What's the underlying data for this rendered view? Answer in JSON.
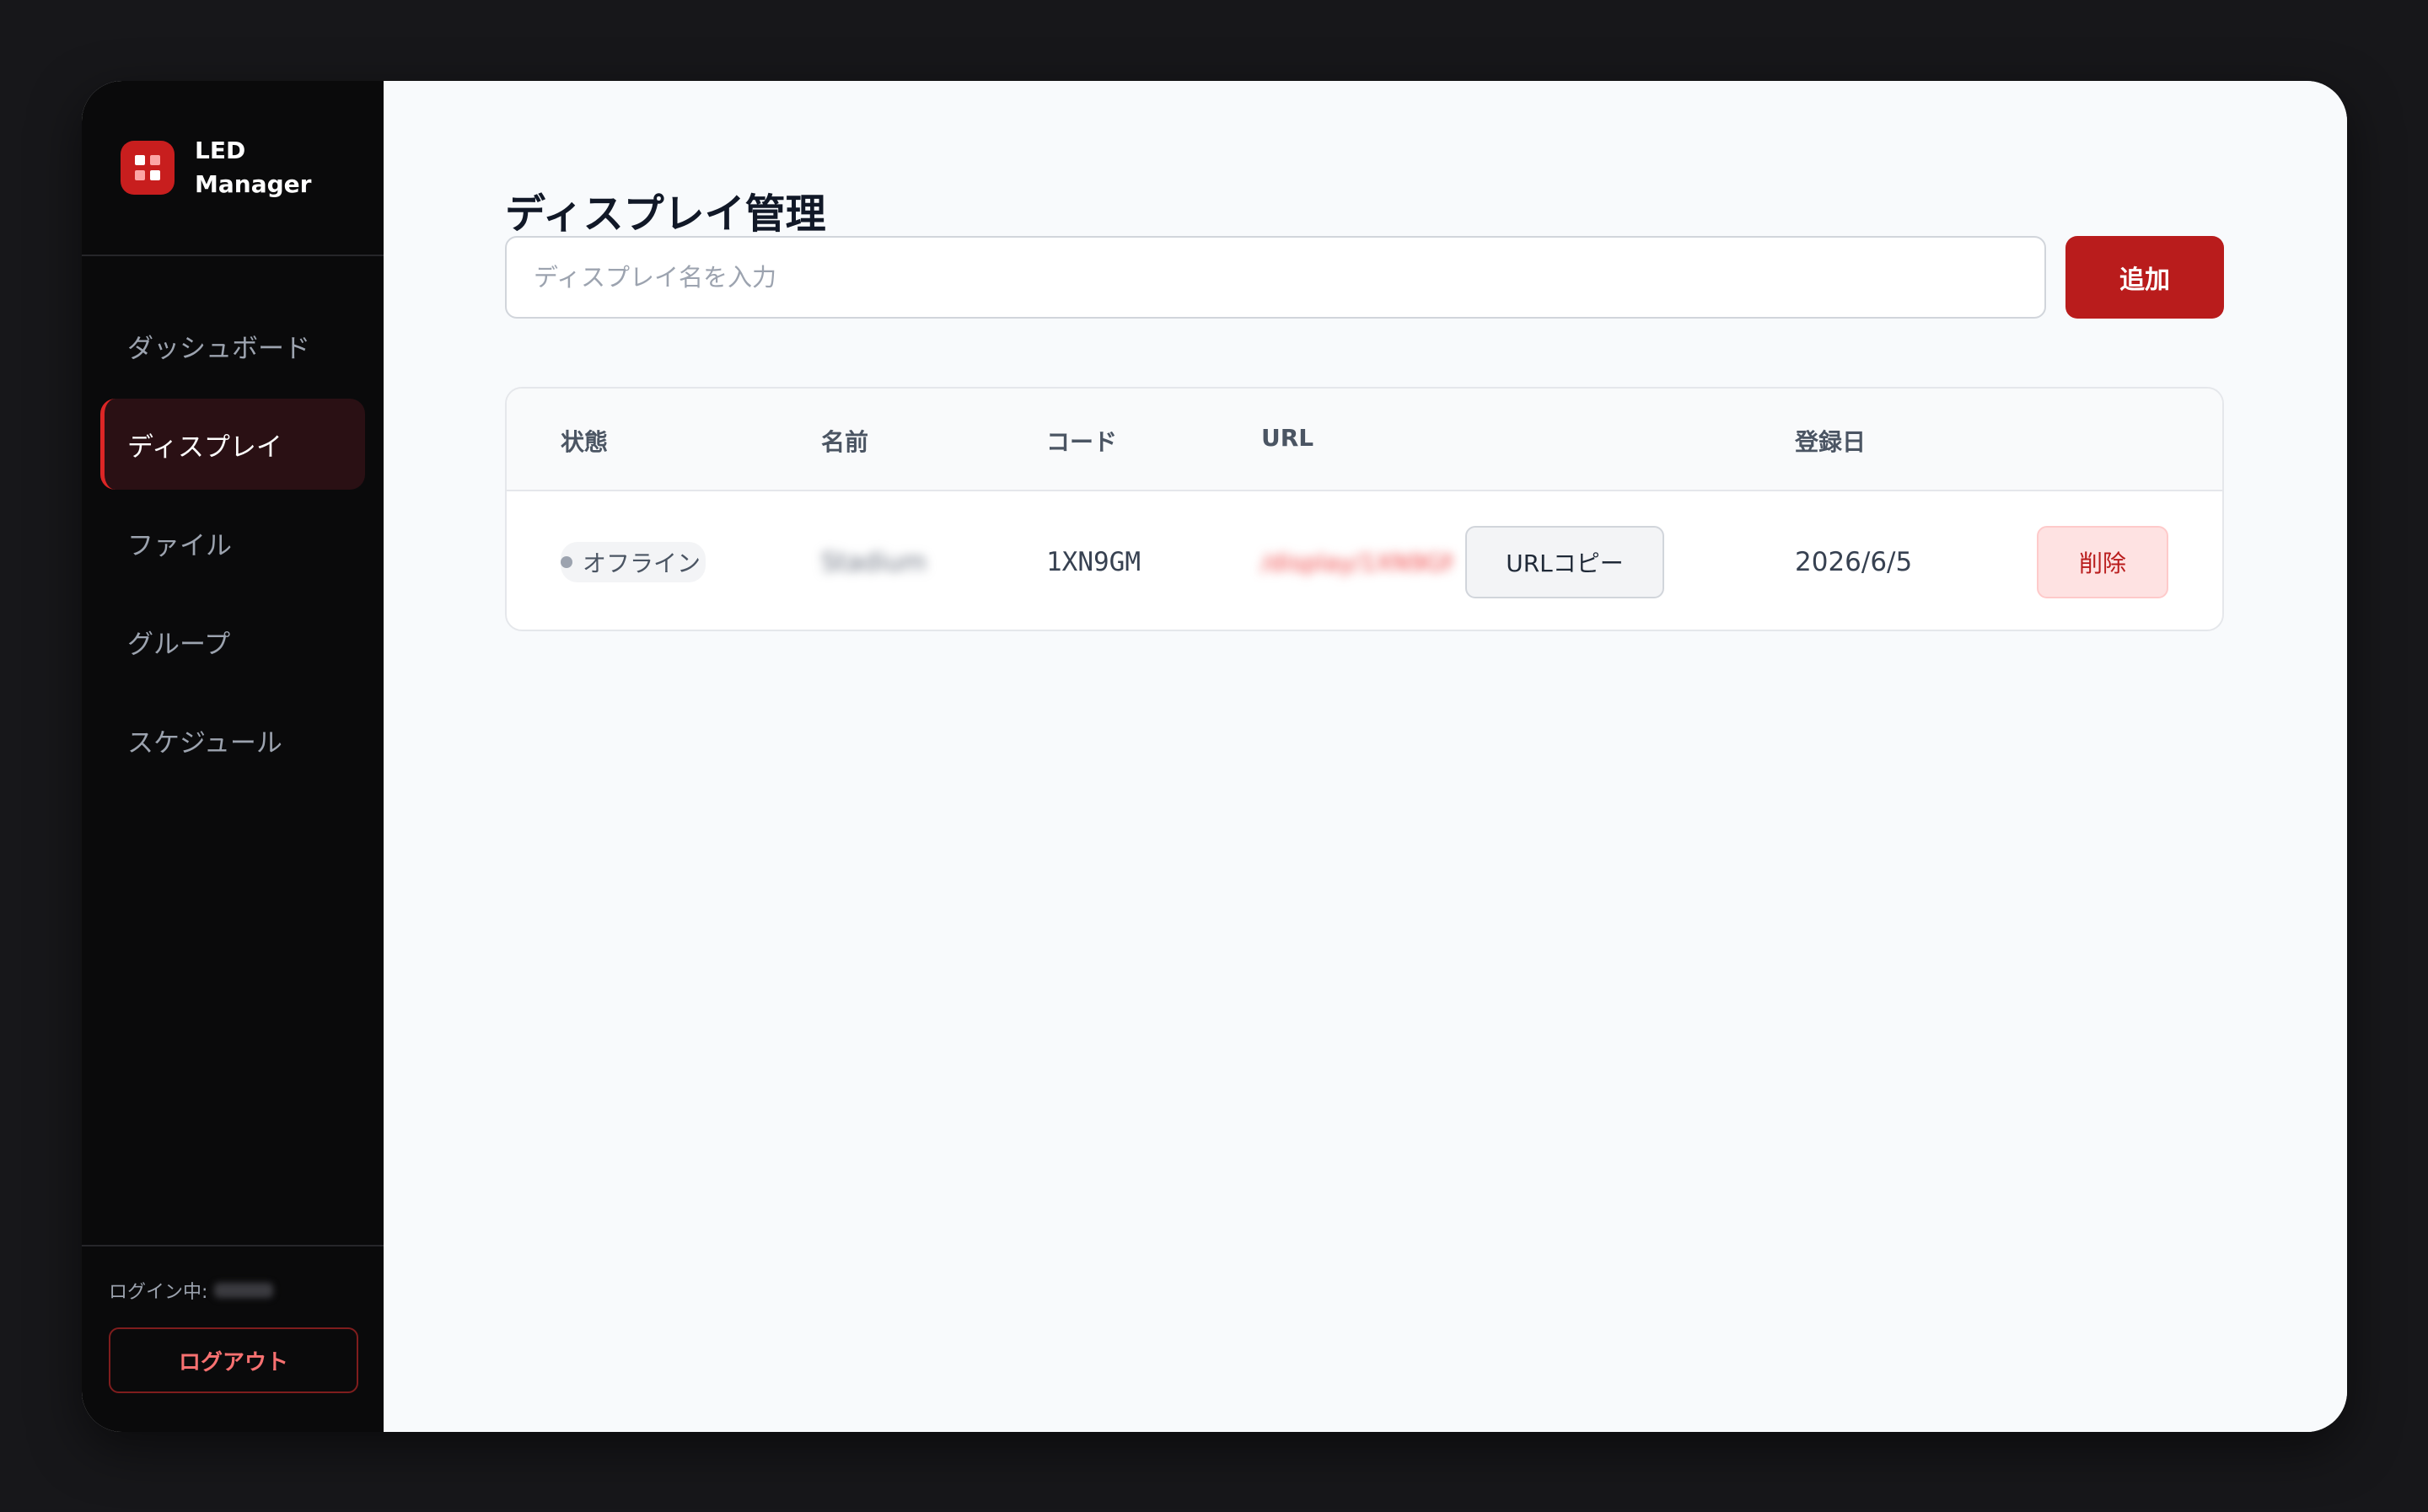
{
  "brand": {
    "name": "LED\nManager",
    "logo_icon": "grid-icon",
    "accent": "#c81e1e"
  },
  "sidebar": {
    "items": [
      {
        "label": "ダッシュボード",
        "active": false
      },
      {
        "label": "ディスプレイ",
        "active": true
      },
      {
        "label": "ファイル",
        "active": false
      },
      {
        "label": "グループ",
        "active": false
      },
      {
        "label": "スケジュール",
        "active": false
      }
    ],
    "login_label": "ログイン中:",
    "logout_label": "ログアウト"
  },
  "main": {
    "title": "ディスプレイ管理",
    "name_input": {
      "placeholder": "ディスプレイ名を入力",
      "value": ""
    },
    "add_label": "追加",
    "table": {
      "headers": [
        "状態",
        "名前",
        "コード",
        "URL",
        "登録日"
      ],
      "rows": [
        {
          "status": "オフライン",
          "name": "Stadium",
          "code": "1XN9GM",
          "url": "/display/1XN9GM",
          "copy_label": "URLコピー",
          "date": "2026/6/5",
          "delete_label": "削除"
        }
      ]
    }
  },
  "colors": {
    "accent": "#b91c1c",
    "sidebar_bg": "#0a0a0b",
    "active_item_bg": "#2a1014",
    "offline_dot": "#9ca3af"
  }
}
